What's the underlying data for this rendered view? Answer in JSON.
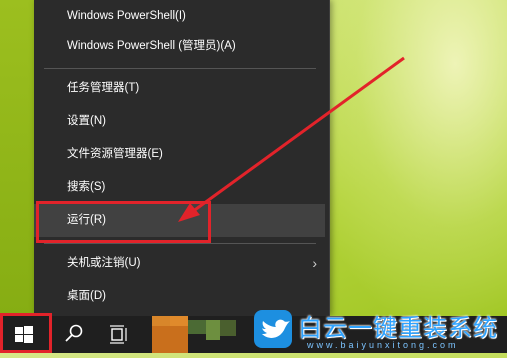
{
  "menu": {
    "items": [
      {
        "label": "Windows PowerShell(I)"
      },
      {
        "label": "Windows PowerShell (管理员)(A)"
      },
      {
        "label": "任务管理器(T)"
      },
      {
        "label": "设置(N)"
      },
      {
        "label": "文件资源管理器(E)"
      },
      {
        "label": "搜索(S)"
      },
      {
        "label": "运行(R)"
      },
      {
        "label": "关机或注销(U)"
      },
      {
        "label": "桌面(D)"
      }
    ],
    "submenu_chevron": "›"
  },
  "colors": {
    "annotation_red": "#e2232a",
    "menu_bg": "#2b2b2b",
    "taskbar_bg": "#1f1f1f",
    "watermark_blue": "#2fa3ff"
  },
  "icons": [
    "windows-logo-icon",
    "search-icon",
    "task-view-icon",
    "bird-logo-icon"
  ],
  "watermark": {
    "text": "白云一键重装系统",
    "url": "www.baiyunxitong.com"
  }
}
